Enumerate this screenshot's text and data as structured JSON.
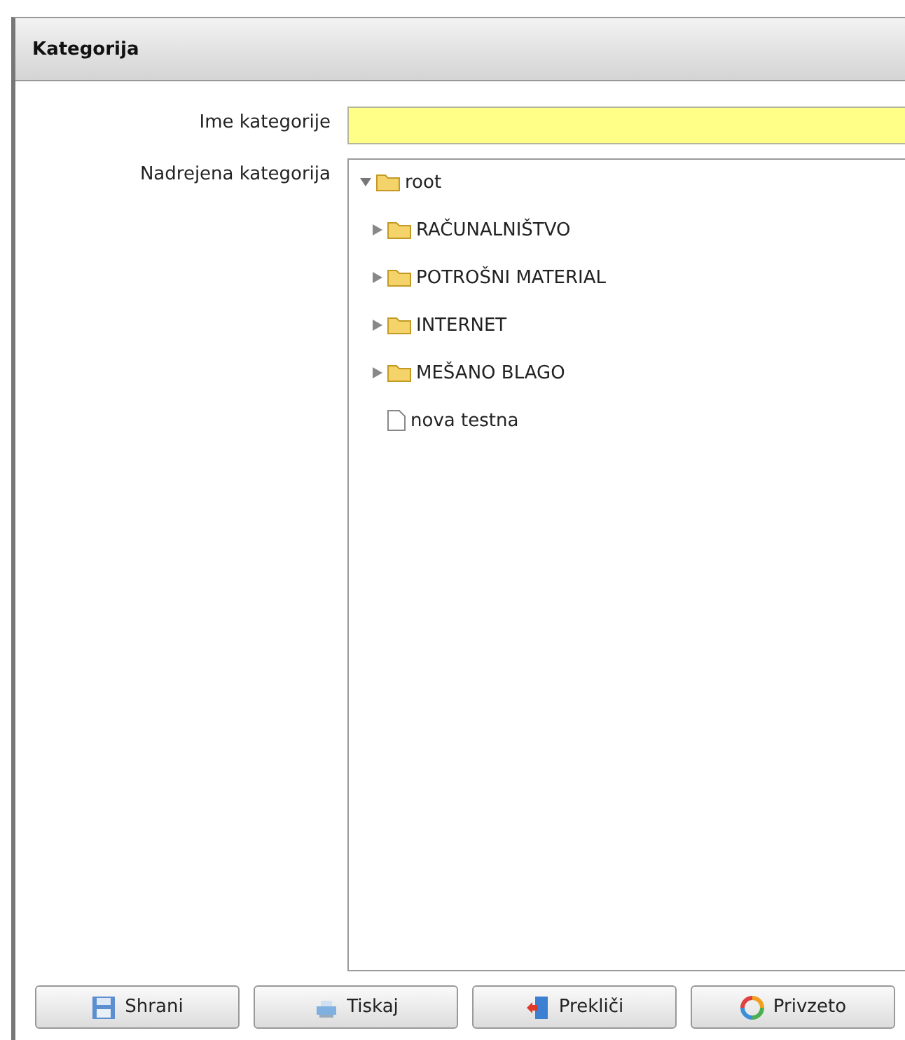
{
  "window": {
    "title": "Kategorija"
  },
  "form": {
    "name_label": "Ime kategorije",
    "parent_label": "Nadrejena kategorija"
  },
  "tree": [
    {
      "kind": "folder",
      "label": "root",
      "expanded": true,
      "children": [
        {
          "kind": "folder",
          "label": "RAČUNALNIŠTVO",
          "expanded": false
        },
        {
          "kind": "folder",
          "label": "POTROŠNI MATERIAL",
          "expanded": false
        },
        {
          "kind": "folder",
          "label": "INTERNET",
          "expanded": false
        },
        {
          "kind": "folder",
          "label": "MEŠANO BLAGO",
          "expanded": false
        },
        {
          "kind": "file",
          "label": "nova testna"
        }
      ]
    }
  ],
  "buttons": [
    {
      "kind": "save",
      "label": "Shrani"
    },
    {
      "kind": "print",
      "label": "Tiskaj"
    },
    {
      "kind": "cancel",
      "label": "Prekliči"
    },
    {
      "kind": "reset",
      "label": "Privzeto"
    }
  ]
}
